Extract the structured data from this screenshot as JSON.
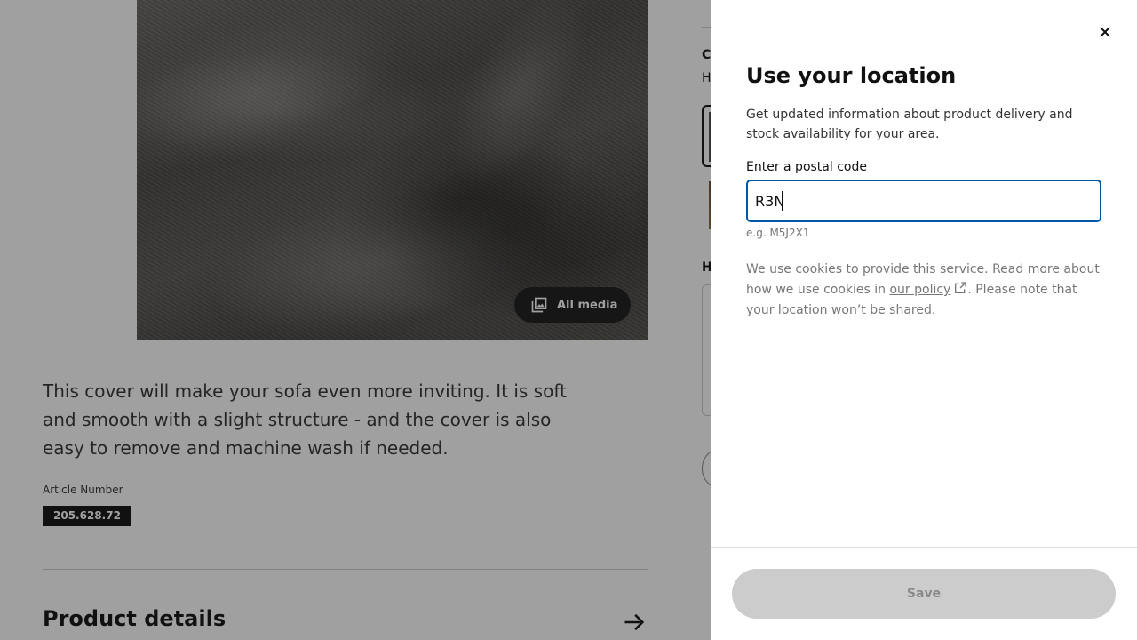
{
  "background": {
    "media_button_label": "All media",
    "description": "This cover will make your sofa even more inviting. It is soft and smooth with a slight structure - and the cover is also easy to remove and machine wash if needed.",
    "article_label": "Article Number",
    "article_number": "205.628.72",
    "product_details_title": "Product details",
    "right_col_c": "C",
    "right_col_h": "H",
    "right_col_h2": "H"
  },
  "modal": {
    "title": "Use your location",
    "description": "Get updated information about product delivery and stock availability for your area.",
    "field_label": "Enter a postal code",
    "postal_value": "R3N",
    "hint": "e.g. M5J2X1",
    "cookie_text_before": "We use cookies to provide this service. Read more about how we use cookies in ",
    "cookie_link": "our policy",
    "cookie_text_after": ". Please note that your location won’t be shared.",
    "save_label": "Save"
  },
  "colors": {
    "focus_border": "#0058a3",
    "overlay": "rgba(17,17,17,0.40)",
    "save_disabled_bg": "#cccccc"
  },
  "icons": {
    "close": "close-icon",
    "media": "image-gallery-icon",
    "external_link": "external-link-icon",
    "arrow": "arrow-right-icon"
  }
}
